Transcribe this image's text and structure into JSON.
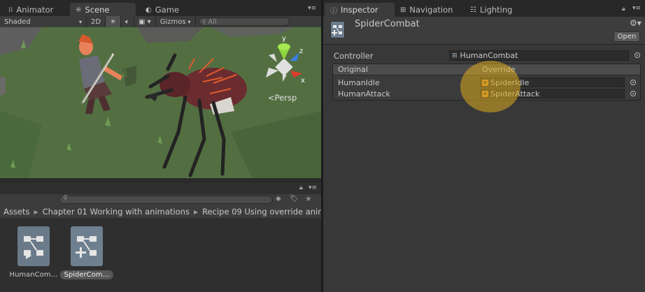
{
  "left_tabs": [
    {
      "label": "Animator",
      "icon": "animator-icon"
    },
    {
      "label": "Scene",
      "icon": "scene-icon",
      "active": true
    },
    {
      "label": "Game",
      "icon": "game-icon"
    }
  ],
  "scene_toolbar": {
    "shading_mode": "Shaded",
    "mode_2d": "2D",
    "gizmos": "Gizmos",
    "search_placeholder": "All"
  },
  "viewport": {
    "projection_label": "Persp",
    "axes": {
      "y": "y",
      "z": "z",
      "x": "x"
    }
  },
  "breadcrumb": [
    "Assets",
    "Chapter 01 Working with animations",
    "Recipe 09 Using override anim"
  ],
  "assets": [
    {
      "label": "HumanCom…",
      "icon": "animator-controller-icon",
      "selected": false
    },
    {
      "label": "SpiderCom…",
      "icon": "animator-override-controller-icon",
      "selected": true
    }
  ],
  "right_tabs": [
    {
      "label": "Inspector",
      "icon": "info-icon",
      "active": true
    },
    {
      "label": "Navigation",
      "icon": "navigation-icon"
    },
    {
      "label": "Lighting",
      "icon": "lighting-icon"
    }
  ],
  "inspector": {
    "object_name": "SpiderCombat",
    "open_button": "Open",
    "controller_label": "Controller",
    "controller_value": "HumanCombat",
    "table": {
      "col_original": "Original",
      "col_override": "Override",
      "rows": [
        {
          "original": "HumanIdle",
          "override": "SpiderIdle"
        },
        {
          "original": "HumanAttack",
          "override": "SpiderAttack"
        }
      ]
    }
  },
  "colors": {
    "highlight": "#dcaa1e",
    "grass": "#50703f",
    "clip_icon": "#c98a2a"
  }
}
